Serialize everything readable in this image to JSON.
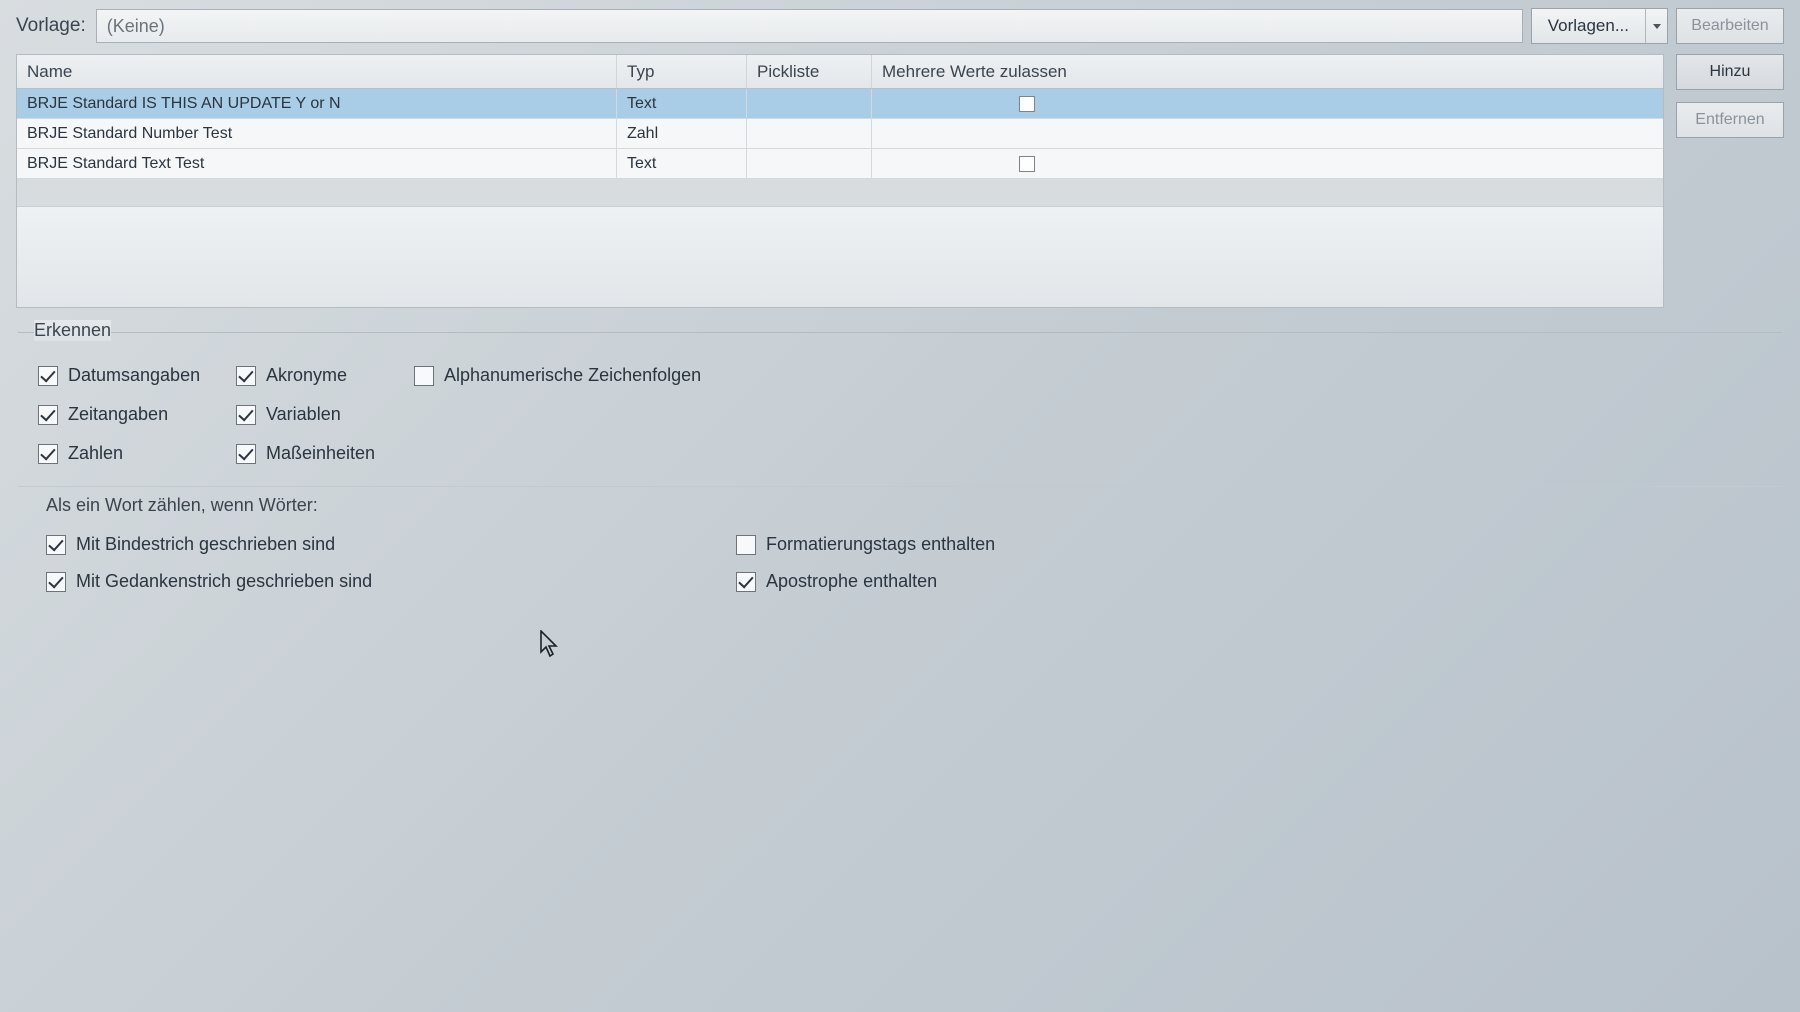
{
  "top": {
    "vorlage_label": "Vorlage:",
    "combo_value": "(Keine)",
    "vorlagen_button": "Vorlagen...",
    "bearbeiten_button": "Bearbeiten"
  },
  "grid": {
    "columns": {
      "name": "Name",
      "type": "Typ",
      "picklist": "Pickliste",
      "multi_values": "Mehrere Werte zulassen"
    },
    "rows": [
      {
        "name": "BRJE Standard IS THIS AN UPDATE Y or N",
        "type": "Text",
        "picklist": "",
        "multi_checkbox": true,
        "selected": true
      },
      {
        "name": "BRJE Standard Number Test",
        "type": "Zahl",
        "picklist": "",
        "multi_checkbox": false,
        "selected": false
      },
      {
        "name": "BRJE Standard Text Test",
        "type": "Text",
        "picklist": "",
        "multi_checkbox": true,
        "selected": false
      }
    ],
    "buttons": {
      "add": "Hinzu",
      "remove": "Entfernen"
    }
  },
  "erkennen": {
    "legend": "Erkennen",
    "items": {
      "datumsangaben": {
        "label": "Datumsangaben",
        "checked": true
      },
      "akronyme": {
        "label": "Akronyme",
        "checked": true
      },
      "alphanum": {
        "label": "Alphanumerische Zeichenfolgen",
        "checked": false
      },
      "zeitangaben": {
        "label": "Zeitangaben",
        "checked": true
      },
      "variablen": {
        "label": "Variablen",
        "checked": true
      },
      "zahlen": {
        "label": "Zahlen",
        "checked": true
      },
      "masseinheiten": {
        "label": "Maßeinheiten",
        "checked": true
      }
    }
  },
  "word_count": {
    "heading": "Als ein Wort zählen, wenn Wörter:",
    "items": {
      "bindestrich": {
        "label": "Mit Bindestrich geschrieben sind",
        "checked": true
      },
      "gedankenstrich": {
        "label": "Mit Gedankenstrich geschrieben sind",
        "checked": true
      },
      "formattags": {
        "label": "Formatierungstags enthalten",
        "checked": false
      },
      "apostrophe": {
        "label": "Apostrophe enthalten",
        "checked": true
      }
    }
  }
}
